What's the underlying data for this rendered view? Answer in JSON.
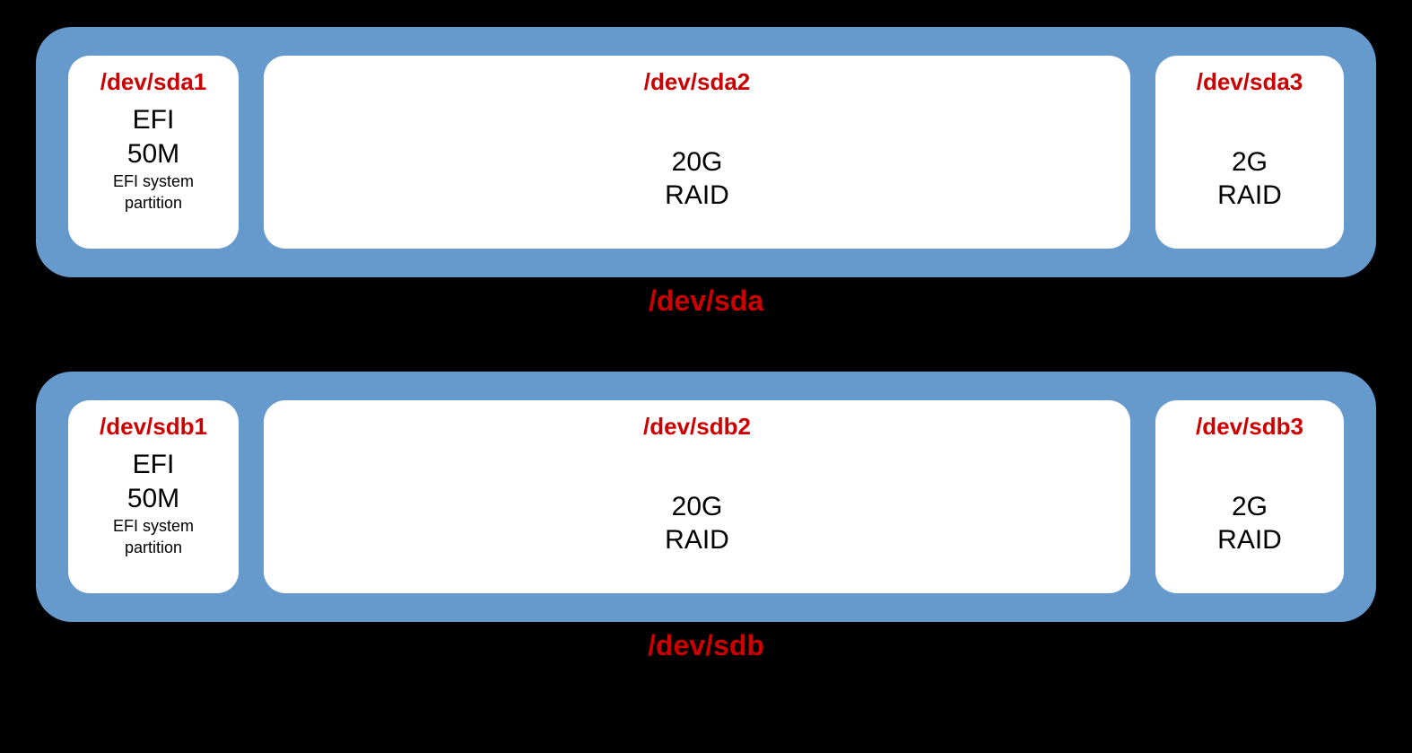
{
  "disks": [
    {
      "device": "/dev/sda",
      "partitions": [
        {
          "device": "/dev/sda1",
          "fs": "EFI",
          "size": "50M",
          "note1": "EFI system",
          "note2": "partition"
        },
        {
          "device": "/dev/sda2",
          "size": "20G",
          "type": "RAID"
        },
        {
          "device": "/dev/sda3",
          "size": "2G",
          "type": "RAID"
        }
      ]
    },
    {
      "device": "/dev/sdb",
      "partitions": [
        {
          "device": "/dev/sdb1",
          "fs": "EFI",
          "size": "50M",
          "note1": "EFI system",
          "note2": "partition"
        },
        {
          "device": "/dev/sdb2",
          "size": "20G",
          "type": "RAID"
        },
        {
          "device": "/dev/sdb3",
          "size": "2G",
          "type": "RAID"
        }
      ]
    }
  ]
}
